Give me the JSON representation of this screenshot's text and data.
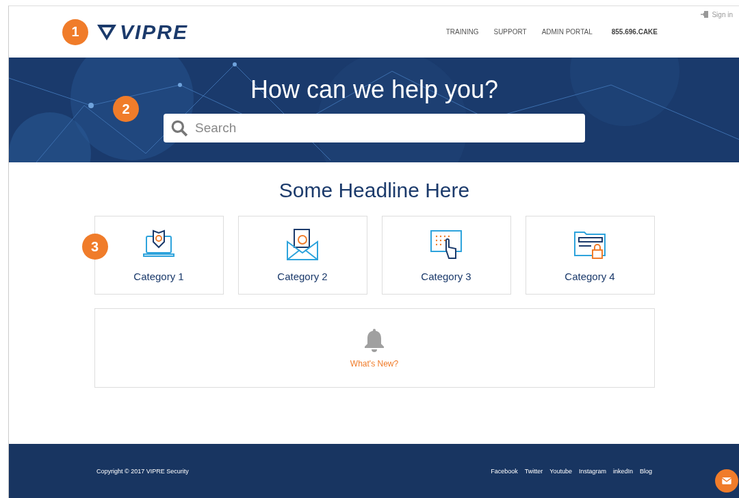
{
  "header": {
    "sign_in": "Sign in",
    "logo": "VIPRE",
    "nav": [
      "TRAINING",
      "SUPPORT",
      "ADMIN PORTAL"
    ],
    "phone": "855.696.CAKE"
  },
  "markers": [
    "1",
    "2",
    "3"
  ],
  "banner": {
    "kind": "picture",
    "title": "How can we help you?",
    "search": {
      "placeholder": "Search"
    }
  },
  "headline": "Some Headline Here",
  "categories": [
    {
      "label": "Category 1",
      "kind": "laptop"
    },
    {
      "label": "Category 2",
      "kind": "envelope"
    },
    {
      "label": "Category 3",
      "kind": "touch"
    },
    {
      "label": "Category 4",
      "kind": "folder"
    }
  ],
  "whats_new": "What's New?",
  "footer": {
    "copyright": "Copyright © 2017 VIPRE Security",
    "links": [
      "Facebook",
      "Twitter",
      "Youtube",
      "Instagram",
      "inkedIn",
      "Blog"
    ]
  }
}
